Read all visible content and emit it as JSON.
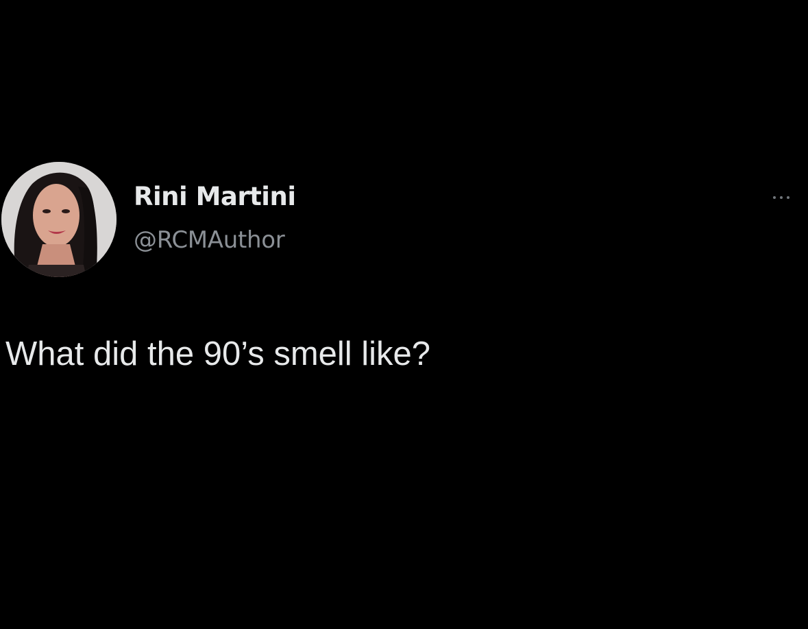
{
  "tweet": {
    "author": {
      "display_name": "Rini Martini",
      "handle": "@RCMAuthor",
      "avatar_icon": "profile-photo"
    },
    "more_icon": "more-horizontal-icon",
    "text": "What did the 90’s smell like?"
  },
  "theme": {
    "background": "#000000",
    "primary_text": "#e7e9ea",
    "secondary_text": "#8b9096"
  }
}
